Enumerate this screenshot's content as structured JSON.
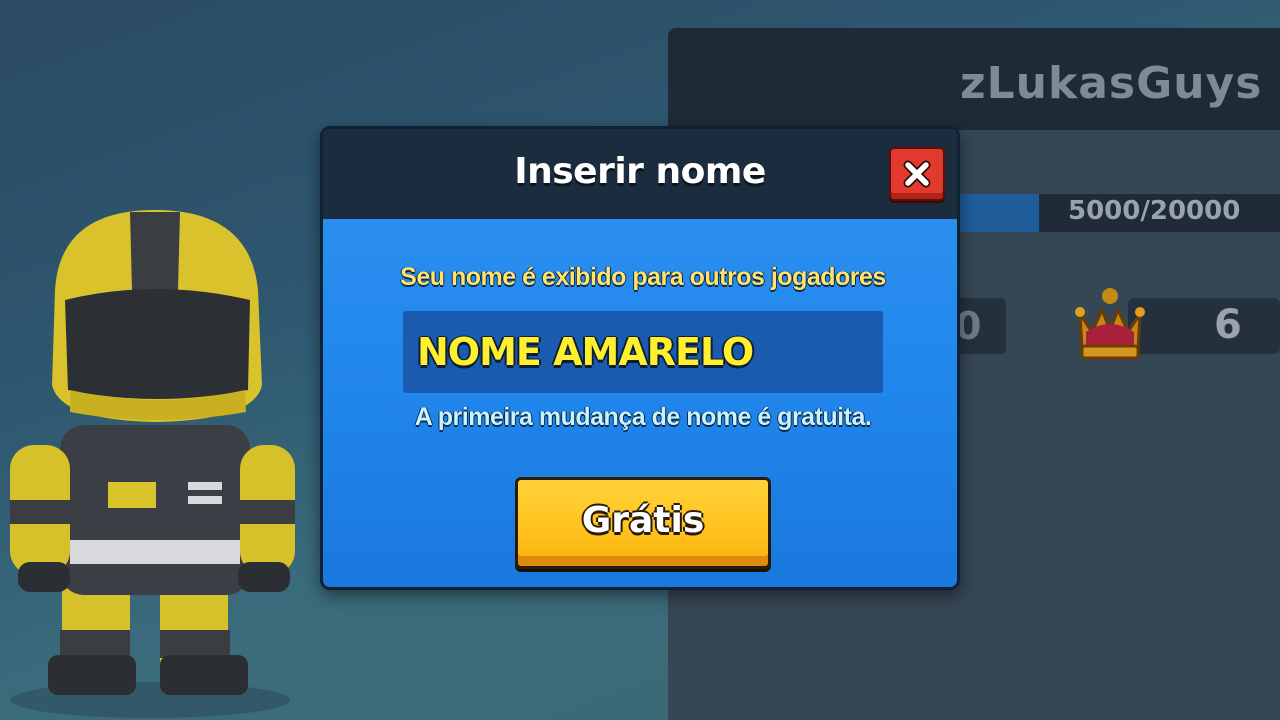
{
  "background": {
    "player_name": "zLukasGuys",
    "xp_progress": "5000/20000",
    "xp_fraction": 0.25,
    "stat_left_partial": "0",
    "stat_right_value": "6",
    "stat_right_icon": "crown-icon"
  },
  "dialog": {
    "title": "Inserir nome",
    "close_icon": "close-icon",
    "subtitle": "Seu nome é exibido para outros jogadores",
    "name_value": "NOME AMARELO",
    "hint": "A primeira mudança de nome é gratuita.",
    "confirm_label": "Grátis"
  },
  "colors": {
    "header": "#1a2c3d",
    "body": "#1e88e5",
    "input": "#1a5bb0",
    "name_text": "#ffef2e",
    "button": "#ffc21c",
    "close_button": "#e23a2e"
  }
}
